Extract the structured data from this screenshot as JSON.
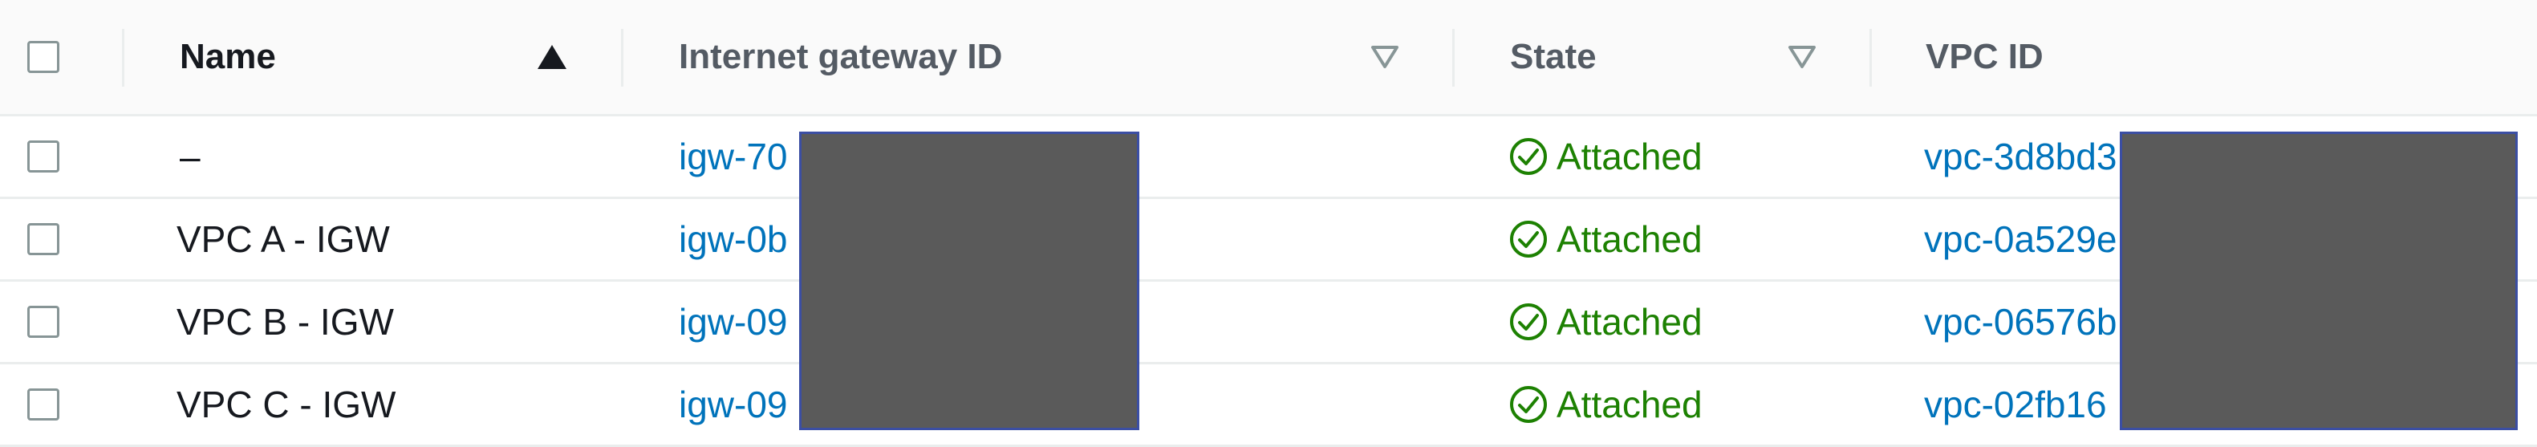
{
  "columns": {
    "name": "Name",
    "igw_id": "Internet gateway ID",
    "state": "State",
    "vpc_id": "VPC ID"
  },
  "rows": [
    {
      "name": "–",
      "igw_id": "igw-70",
      "state": "Attached",
      "vpc_id": "vpc-3d8bd3"
    },
    {
      "name": "VPC A - IGW",
      "igw_id": "igw-0b",
      "state": "Attached",
      "vpc_id": "vpc-0a529e"
    },
    {
      "name": "VPC B - IGW",
      "igw_id": "igw-09",
      "state": "Attached",
      "vpc_id": "vpc-06576b"
    },
    {
      "name": "VPC C - IGW",
      "igw_id": "igw-09",
      "state": "Attached",
      "vpc_id": "vpc-02fb16"
    }
  ],
  "icons": {
    "sort": "sort-ascending-icon",
    "filter": "filter-triangle-icon",
    "state": "check-circle-icon"
  },
  "colors": {
    "link": "#0073bb",
    "attached": "#1d8102",
    "header_text": "#545b64",
    "redaction": "#5a5a5a"
  }
}
